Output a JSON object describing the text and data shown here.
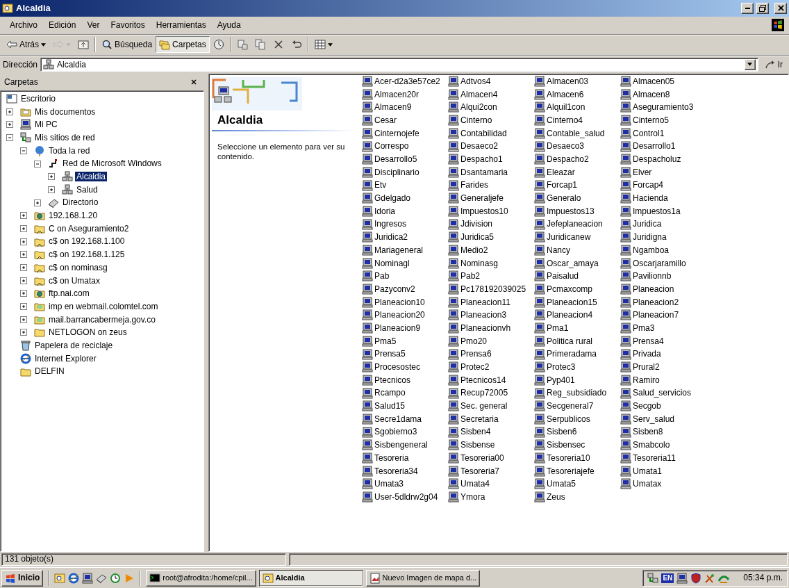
{
  "window": {
    "title": "Alcaldia"
  },
  "menu": [
    "Archivo",
    "Edición",
    "Ver",
    "Favoritos",
    "Herramientas",
    "Ayuda"
  ],
  "toolbar": [
    {
      "kind": "back",
      "label": "Atrás",
      "dropdown": true,
      "selected": false,
      "disabled": false
    },
    {
      "kind": "forward",
      "dropdown": true,
      "selected": false,
      "disabled": true
    },
    {
      "kind": "up",
      "dropdown": false,
      "selected": false,
      "disabled": false
    },
    {
      "kind": "separator"
    },
    {
      "kind": "search",
      "label": "Búsqueda",
      "dropdown": false,
      "selected": false,
      "disabled": false
    },
    {
      "kind": "folders",
      "label": "Carpetas",
      "dropdown": false,
      "selected": true,
      "disabled": false
    },
    {
      "kind": "history",
      "dropdown": false,
      "selected": false,
      "disabled": false
    },
    {
      "kind": "separator"
    },
    {
      "kind": "move",
      "dropdown": false,
      "selected": false,
      "disabled": false
    },
    {
      "kind": "copy",
      "dropdown": false,
      "selected": false,
      "disabled": false
    },
    {
      "kind": "delete",
      "dropdown": false,
      "selected": false,
      "disabled": false
    },
    {
      "kind": "undo",
      "dropdown": false,
      "selected": false,
      "disabled": false
    },
    {
      "kind": "separator"
    },
    {
      "kind": "views",
      "dropdown": true,
      "selected": false,
      "disabled": false
    }
  ],
  "address": {
    "label": "Dirección",
    "value": "Alcaldia",
    "go": "Ir"
  },
  "folders_pane": {
    "title": "Carpetas"
  },
  "tree": [
    {
      "label": "Escritorio",
      "kind": "desktop",
      "selected": false,
      "children": [
        {
          "label": "Mis documentos",
          "kind": "documents",
          "expanded": false,
          "selected": false
        },
        {
          "label": "Mi PC",
          "kind": "computer",
          "expanded": false,
          "selected": false
        },
        {
          "label": "Mis sitios de red",
          "kind": "network",
          "expanded": true,
          "selected": false,
          "children": [
            {
              "label": "Toda la red",
              "kind": "globe",
              "expanded": true,
              "selected": false,
              "children": [
                {
                  "label": "Red de Microsoft Windows",
                  "kind": "windows-network",
                  "expanded": true,
                  "selected": false,
                  "children": [
                    {
                      "label": "Alcaldia",
                      "kind": "workgroup",
                      "expanded": false,
                      "selected": true
                    },
                    {
                      "label": "Salud",
                      "kind": "workgroup",
                      "expanded": false,
                      "selected": false
                    }
                  ]
                },
                {
                  "label": "Directorio",
                  "kind": "directory",
                  "expanded": false,
                  "selected": false
                }
              ]
            },
            {
              "label": "192.168.1.20",
              "kind": "ftp",
              "expanded": false,
              "selected": false
            },
            {
              "label": "C on Aseguramiento2",
              "kind": "share",
              "expanded": false,
              "selected": false
            },
            {
              "label": "c$ on 192.168.1.100",
              "kind": "share",
              "expanded": false,
              "selected": false
            },
            {
              "label": "c$ on 192.168.1.125",
              "kind": "share",
              "expanded": false,
              "selected": false
            },
            {
              "label": "c$ on nominasg",
              "kind": "share",
              "expanded": false,
              "selected": false
            },
            {
              "label": "c$ on Umatax",
              "kind": "share",
              "expanded": false,
              "selected": false
            },
            {
              "label": "ftp.nai.com",
              "kind": "ftp",
              "expanded": false,
              "selected": false
            },
            {
              "label": "imp en webmail.colomtel.com",
              "kind": "web-folder",
              "expanded": false,
              "selected": false
            },
            {
              "label": "mail.barrancabermeja.gov.co",
              "kind": "web-folder",
              "expanded": false,
              "selected": false
            },
            {
              "label": "NETLOGON on zeus",
              "kind": "folder",
              "expanded": false,
              "selected": false
            }
          ]
        },
        {
          "label": "Papelera de reciclaje",
          "kind": "recycle",
          "selected": false
        },
        {
          "label": "Internet Explorer",
          "kind": "browser",
          "selected": false
        },
        {
          "label": "DELFIN",
          "kind": "folder",
          "selected": false
        }
      ]
    }
  ],
  "web_view": {
    "title": "Alcaldia",
    "text": "Seleccione un elemento para ver su contenido."
  },
  "computers": [
    "Acer-d2a3e57ce2",
    "Adtvos4",
    "Almacen03",
    "Almacen05",
    "Almacen20r",
    "Almacen4",
    "Almacen6",
    "Almacen8",
    "Almacen9",
    "Alqui2con",
    "Alquil1con",
    "Aseguramiento3",
    "Cesar",
    "Cinterno",
    "Cinterno4",
    "Cinterno5",
    "Cinternojefe",
    "Contabilidad",
    "Contable_salud",
    "Control1",
    "Correspo",
    "Desaeco2",
    "Desaeco3",
    "Desarrollo1",
    "Desarrollo5",
    "Despacho1",
    "Despacho2",
    "Despacholuz",
    "Disciplinario",
    "Dsantamaria",
    "Eleazar",
    "Elver",
    "Etv",
    "Farides",
    "Forcap1",
    "Forcap4",
    "Gdelgado",
    "Generaljefe",
    "Generalo",
    "Hacienda",
    "Idoria",
    "Impuestos10",
    "Impuestos13",
    "Impuestos1a",
    "Ingresos",
    "Jdivision",
    "Jefeplaneacion",
    "Juridica",
    "Juridica2",
    "Juridica5",
    "Juridicanew",
    "Juridigna",
    "Mariageneral",
    "Medio2",
    "Nancy",
    "Ngamboa",
    "Nominagl",
    "Nominasg",
    "Oscar_amaya",
    "Oscarjaramillo",
    "Pab",
    "Pab2",
    "Paisalud",
    "Pavilionnb",
    "Pazyconv2",
    "Pc178192039025",
    "Pcmaxcomp",
    "Planeacion",
    "Planeacion10",
    "Planeacion11",
    "Planeacion15",
    "Planeacion2",
    "Planeacion20",
    "Planeacion3",
    "Planeacion4",
    "Planeacion7",
    "Planeacion9",
    "Planeacionvh",
    "Pma1",
    "Pma3",
    "Pma5",
    "Pmo20",
    "Politica rural",
    "Prensa4",
    "Prensa5",
    "Prensa6",
    "Primeradama",
    "Privada",
    "Procesostec",
    "Protec2",
    "Protec3",
    "Prural2",
    "Ptecnicos",
    "Ptecnicos14",
    "Pyp401",
    "Ramiro",
    "Rcampo",
    "Recup72005",
    "Reg_subsidiado",
    "Salud_servicios",
    "Salud15",
    "Sec. general",
    "Secgeneral7",
    "Secgob",
    "Secre1dama",
    "Secretaria",
    "Serpublicos",
    "Serv_salud",
    "Sgobierno3",
    "Sisben4",
    "Sisben6",
    "Sisben8",
    "Sisbengeneral",
    "Sisbense",
    "Sisbensec",
    "Smabcolo",
    "Tesoreria",
    "Tesoreria00",
    "Tesoreria10",
    "Tesoreria11",
    "Tesoreria34",
    "Tesoreria7",
    "Tesoreriajefe",
    "Umata1",
    "Umata3",
    "Umata4",
    "Umata5",
    "Umatax",
    "User-5dldrw2g04",
    "Ymora",
    "Zeus"
  ],
  "status_bar": "131 objeto(s)",
  "taskbar": {
    "start": "Inicio",
    "quick_launch": [
      {
        "kind": "explorer"
      },
      {
        "kind": "browser"
      },
      {
        "kind": "computer"
      },
      {
        "kind": "directory"
      },
      {
        "kind": "clock"
      },
      {
        "kind": "media"
      }
    ],
    "tasks": [
      {
        "label": "root@afrodita:/home/cpil...",
        "kind": "terminal",
        "selected": false
      },
      {
        "label": "Alcaldia",
        "kind": "explorer",
        "selected": true
      },
      {
        "label": "Nuevo Imagen de mapa d...",
        "kind": "image",
        "selected": false
      }
    ],
    "tray": {
      "language": "EN",
      "icons": [
        {
          "kind": "network"
        },
        {
          "kind": "computer"
        },
        {
          "kind": "shield"
        },
        {
          "kind": "tools"
        },
        {
          "kind": "antivirus"
        }
      ]
    },
    "clock": "05:34 p.m."
  }
}
